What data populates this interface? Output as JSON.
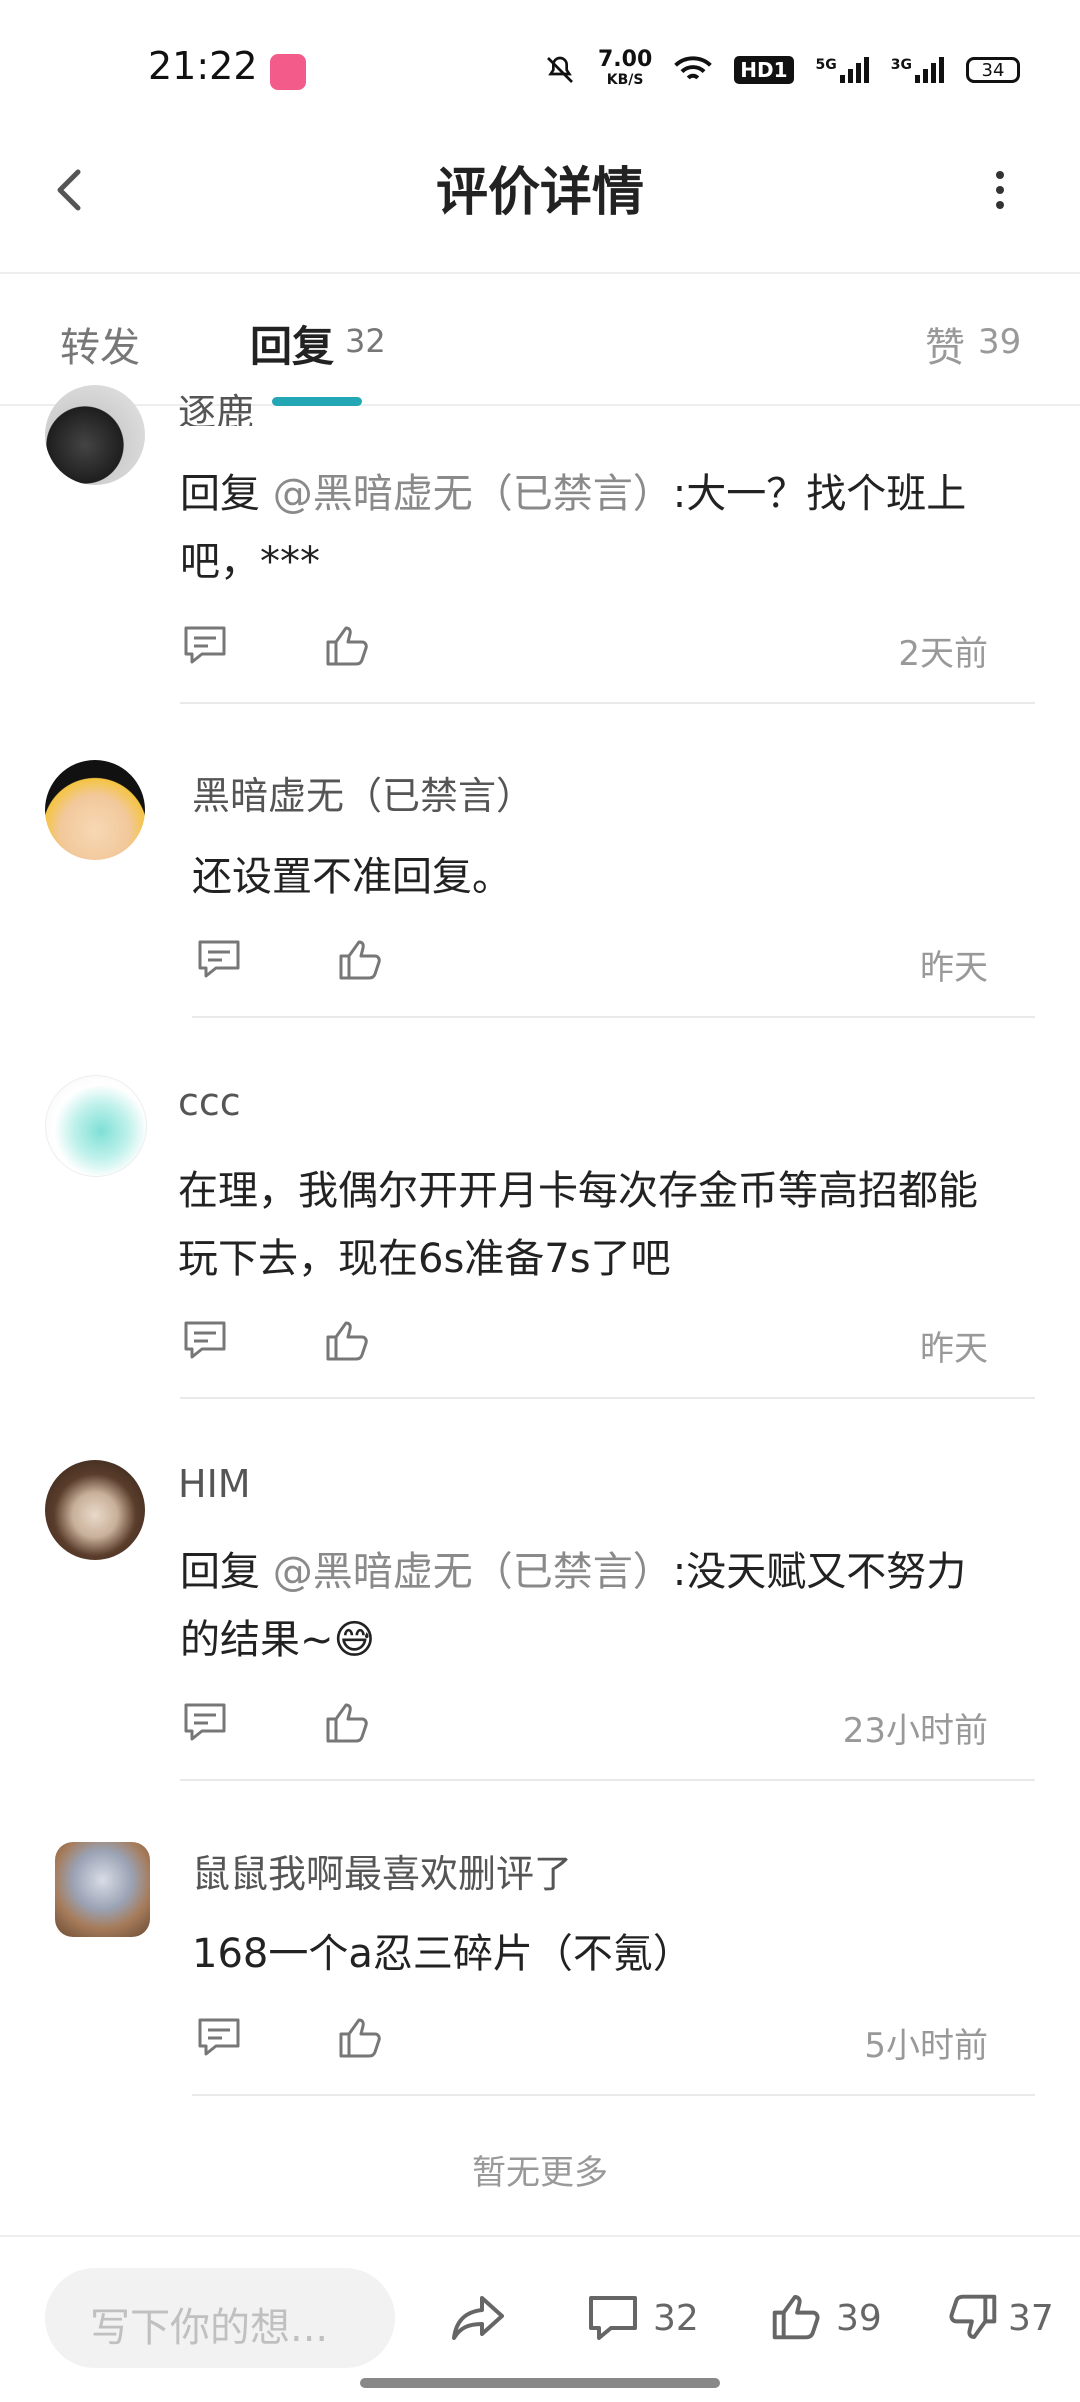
{
  "status_bar": {
    "time": "21:22",
    "net_speed_value": "7.00",
    "net_speed_unit": "KB/S",
    "hd_label": "HD1",
    "signal1": "5G",
    "signal2": "3G",
    "battery": "34"
  },
  "header": {
    "title": "评价详情"
  },
  "tabs": {
    "repost": "转发",
    "reply": "回复",
    "reply_count": "32",
    "like": "赞",
    "like_count": "39"
  },
  "comments": [
    {
      "username": "逐鹿",
      "reply_prefix": "回复 ",
      "mention": "@黑暗虚无（已禁言）",
      "text_line1": ":大一？找个班上",
      "text_line2": "吧，***",
      "time": "2天前"
    },
    {
      "username": "黑暗虚无（已禁言）",
      "text": "还设置不准回复。",
      "time": "昨天"
    },
    {
      "username": "ccc",
      "text_line1": "在理，我偶尔开开月卡每次存金币等高招都能",
      "text_line2": "玩下去，现在6s准备7s了吧",
      "time": "昨天"
    },
    {
      "username": "HIM",
      "reply_prefix": "回复 ",
      "mention": "@黑暗虚无（已禁言）",
      "text_line1": ":没天赋又不努力",
      "text_line2": "的结果~😅",
      "time": "23小时前"
    },
    {
      "username": "鼠鼠我啊最喜欢删评了",
      "text": "168一个a忍三碎片（不氪）",
      "time": "5小时前"
    }
  ],
  "no_more": "暂无更多",
  "bottom_bar": {
    "input_placeholder": "写下你的想...",
    "comment_count": "32",
    "like_count": "39",
    "dislike_count": "37"
  }
}
